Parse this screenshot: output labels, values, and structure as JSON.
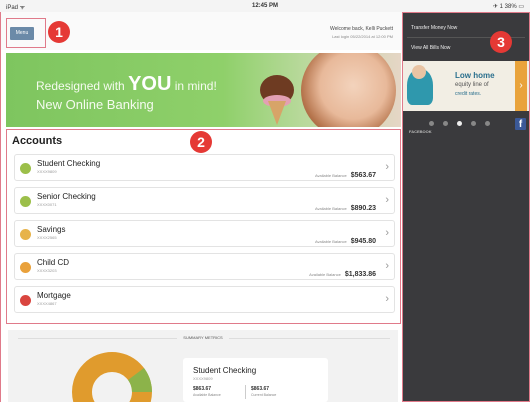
{
  "status_bar": {
    "carrier": "iPad ᯤ",
    "time": "12:45 PM",
    "battery": "✈ 1 38% ▭"
  },
  "header": {
    "menu_label": "Menu",
    "welcome": "Welcome back, Kelli Puckett",
    "last_login": "Last login 05/22/2014 at 12:00 PM"
  },
  "banner": {
    "line1_prefix": "Redesigned with",
    "line1_emphasis": "YOU",
    "line1_suffix": "in mind!",
    "line2": "New Online Banking"
  },
  "badges": [
    "1",
    "2",
    "3"
  ],
  "accounts": {
    "title": "Accounts",
    "items": [
      {
        "name": "Student Checking",
        "number": "XXXX9809",
        "label": "Available Balance",
        "balance": "$563.67",
        "color": "#9cbf4a"
      },
      {
        "name": "Senior Checking",
        "number": "XXXX0071",
        "label": "Available Balance",
        "balance": "$890.23",
        "color": "#9cbf4a"
      },
      {
        "name": "Savings",
        "number": "XXXX2565",
        "label": "Available Balance",
        "balance": "$945.80",
        "color": "#e7b34a"
      },
      {
        "name": "Child CD",
        "number": "XXXX3203",
        "label": "Available Balance",
        "balance": "$1,833.86",
        "color": "#e9a13b"
      },
      {
        "name": "Mortgage",
        "number": "XXXX4867",
        "label": "",
        "balance": "",
        "color": "#d9453f"
      }
    ]
  },
  "summary": {
    "title": "SUMMARY METRICS",
    "account_name": "Student Checking",
    "account_number": "XXXX9809",
    "available_value": "$863.67",
    "available_label": "Available Balance",
    "current_value": "$863.67",
    "current_label": "Current Balance",
    "colors": {
      "main": "#e09b2d",
      "accent": "#8cb34a"
    }
  },
  "sidebar": {
    "transfer": "Transfer Money Now",
    "bills": "View All Bills Now",
    "promo_title": "Low home",
    "promo_sub": "equity line of",
    "promo_sub2": "credit rates.",
    "promo_next": "›",
    "facebook_label": "FACEBOOK",
    "facebook_icon": "f"
  },
  "icons": {
    "chevron": "›"
  }
}
